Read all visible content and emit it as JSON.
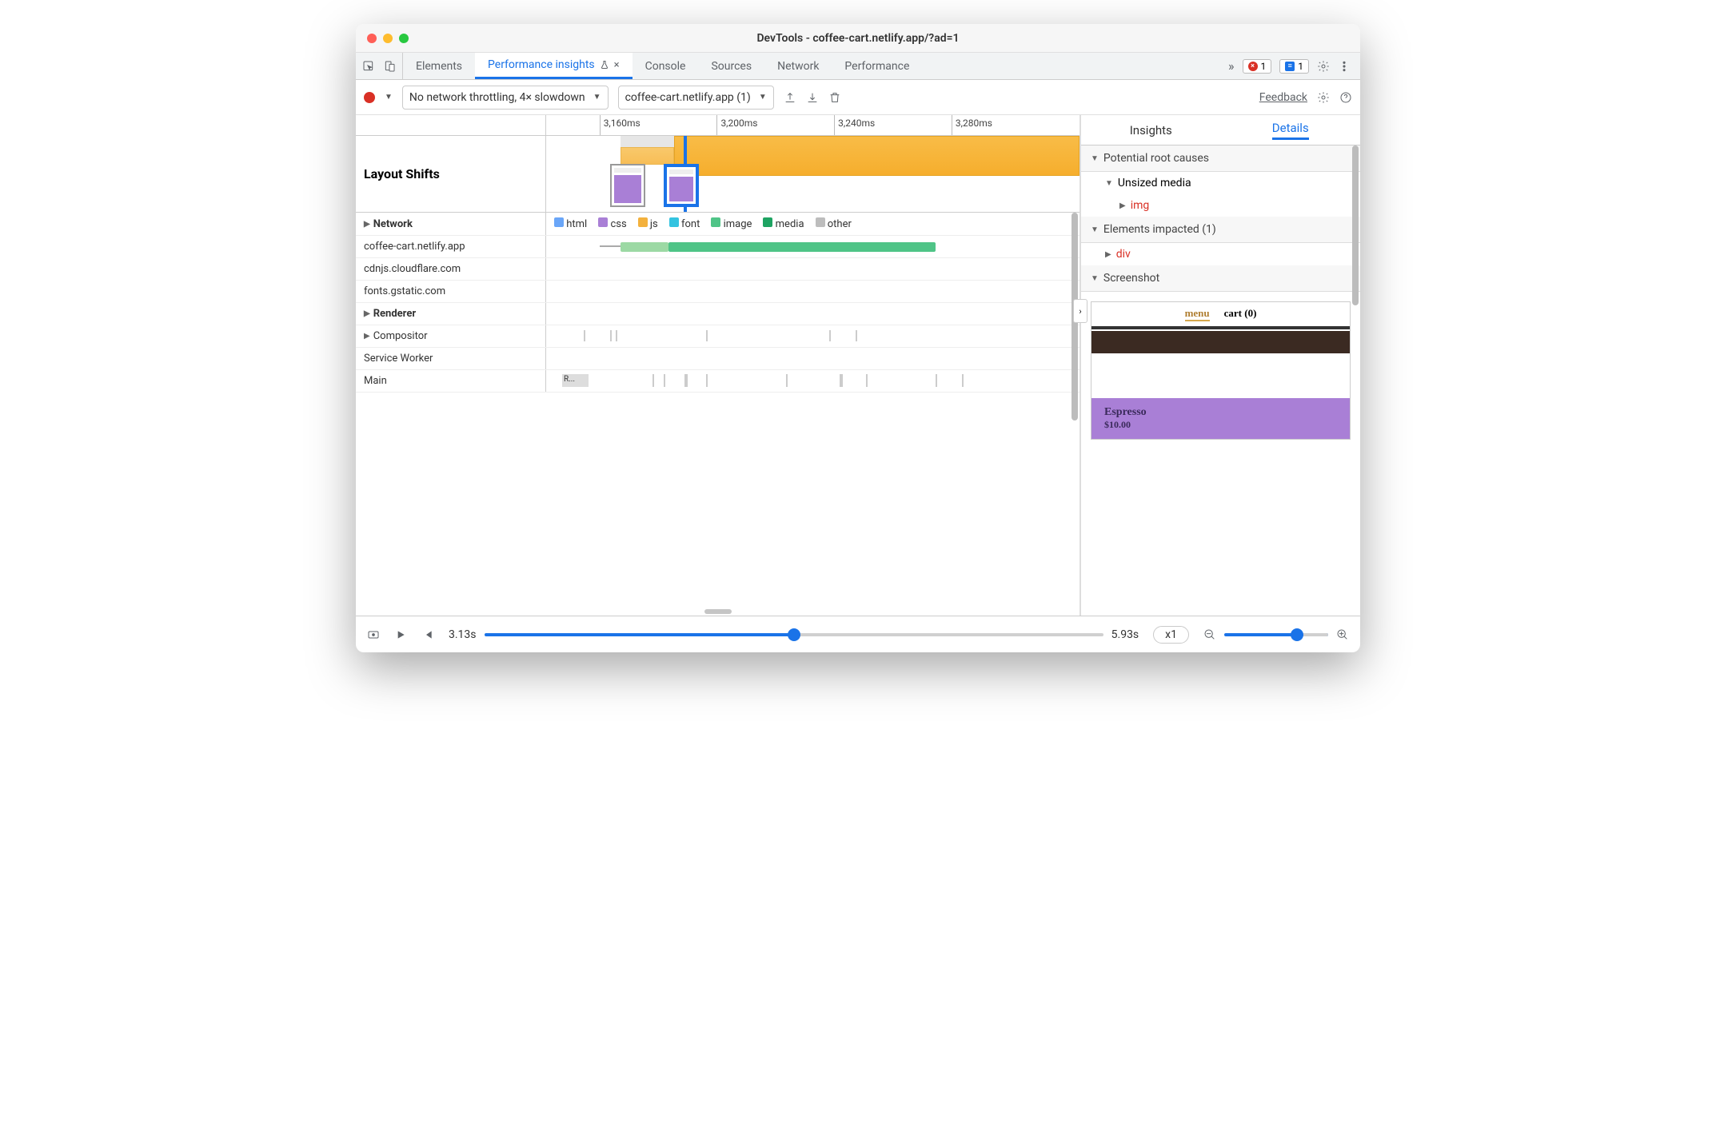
{
  "window": {
    "title": "DevTools - coffee-cart.netlify.app/?ad=1"
  },
  "tabbar": {
    "tabs": [
      "Elements",
      "Performance insights",
      "Console",
      "Sources",
      "Network",
      "Performance"
    ],
    "active_index": 1,
    "overflow_glyph": "»",
    "errors": "1",
    "messages": "1"
  },
  "toolbar": {
    "throttling": "No network throttling, 4× slowdown",
    "recording_select": "coffee-cart.netlify.app (1)",
    "feedback": "Feedback"
  },
  "ruler": {
    "ticks": [
      "3,160ms",
      "3,200ms",
      "3,240ms",
      "3,280ms"
    ]
  },
  "tracks": {
    "layout_shifts_label": "Layout Shifts",
    "network_label": "Network",
    "network_legend": [
      {
        "label": "html",
        "color": "#6aa6f8"
      },
      {
        "label": "css",
        "color": "#a97fd6"
      },
      {
        "label": "js",
        "color": "#f3b13d"
      },
      {
        "label": "font",
        "color": "#33c3e0"
      },
      {
        "label": "image",
        "color": "#4fc487"
      },
      {
        "label": "media",
        "color": "#1ea362"
      },
      {
        "label": "other",
        "color": "#bdbdbd"
      }
    ],
    "network_hosts": [
      "coffee-cart.netlify.app",
      "cdnjs.cloudflare.com",
      "fonts.gstatic.com"
    ],
    "renderer_label": "Renderer",
    "renderer_rows": [
      "Compositor",
      "Service Worker",
      "Main"
    ],
    "main_block": "R..."
  },
  "details": {
    "tabs": [
      "Insights",
      "Details"
    ],
    "active_index": 1,
    "root_causes": "Potential root causes",
    "unsized": "Unsized media",
    "unsized_item": "img",
    "impacted": "Elements impacted (1)",
    "impacted_item": "div",
    "screenshot": "Screenshot",
    "ss_menu": "menu",
    "ss_cart": "cart (0)",
    "ss_name": "Espresso",
    "ss_price": "$10.00"
  },
  "footer": {
    "t_start": "3.13s",
    "t_end": "5.93s",
    "speed": "x1"
  }
}
